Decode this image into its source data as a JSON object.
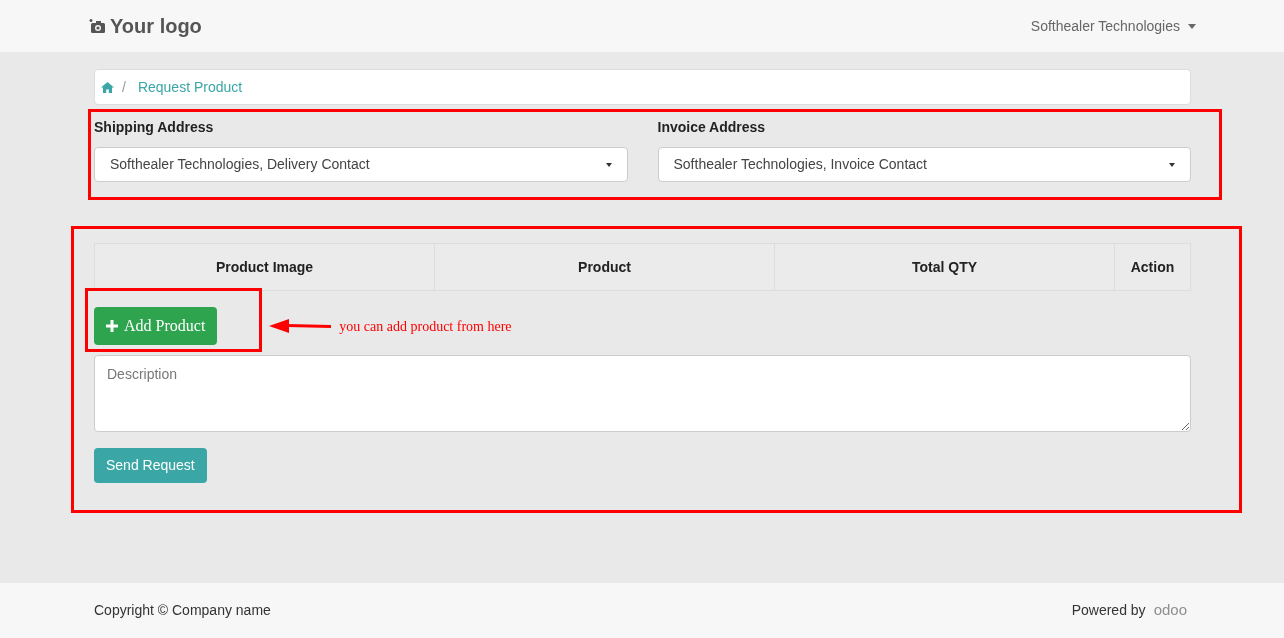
{
  "header": {
    "logo": "Your logo",
    "user_menu": "Softhealer Technologies"
  },
  "breadcrumb": {
    "separator": "/",
    "current": "Request Product"
  },
  "addresses": [
    {
      "label": "Shipping Address",
      "value": "Softhealer Technologies, Delivery Contact"
    },
    {
      "label": "Invoice Address",
      "value": "Softhealer Technologies, Invoice Contact"
    }
  ],
  "table": {
    "columns": [
      "Product Image",
      "Product",
      "Total QTY",
      "Action"
    ]
  },
  "add_button": "Add Product",
  "annotation": "you can add product from here",
  "description": {
    "placeholder": "Description"
  },
  "submit_button": "Send Request",
  "footer": {
    "copyright": "Copyright © Company name",
    "powered_by": "Powered by",
    "brand": "odoo"
  }
}
